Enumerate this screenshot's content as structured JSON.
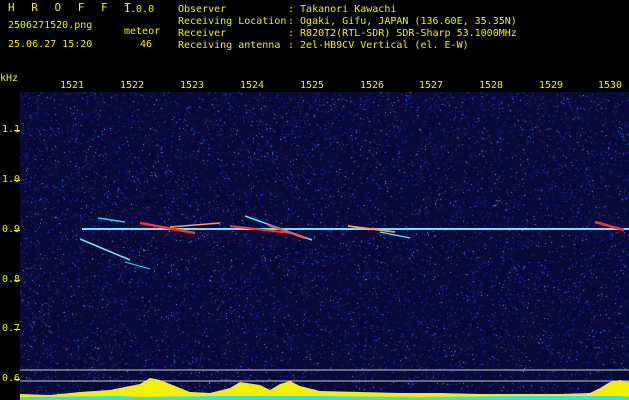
{
  "header": {
    "app_title": "H R O F F T",
    "version": "1.0.0",
    "filename": "2506271520.png",
    "detect_label": "meteor",
    "datetime": "25.06.27 15:20",
    "count": "46",
    "info": [
      {
        "label": "Observer",
        "value": ": Takanori Kawachi"
      },
      {
        "label": "Receiving Location",
        "value": ": Ogaki, Gifu, JAPAN (136.60E, 35.35N)"
      },
      {
        "label": "Receiver",
        "value": ": R820T2(RTL-SDR) SDR-Sharp 53.1000MHz"
      },
      {
        "label": "Receiving antenna",
        "value": ": 2el-HB9CV Vertical (el. E-W)"
      }
    ]
  },
  "axes": {
    "y_unit": "kHz",
    "x_ticks": [
      "1521",
      "1522",
      "1523",
      "1524",
      "1525",
      "1526",
      "1527",
      "1528",
      "1529",
      "1530"
    ],
    "y_ticks": [
      "1.1",
      "1.0",
      "0.9",
      "0.8",
      "0.7",
      "0.6"
    ]
  },
  "colors": {
    "background": "#000000",
    "text_cyan": "#3ff7f0",
    "text_yellow": "#f2f000",
    "spectrogram_bg": "#0a0a3a",
    "carrier": "#6fe0ff",
    "meteor_hot": "#ff3030",
    "level_yellow": "#f2f000",
    "level_cyan": "#19e8ff"
  }
}
